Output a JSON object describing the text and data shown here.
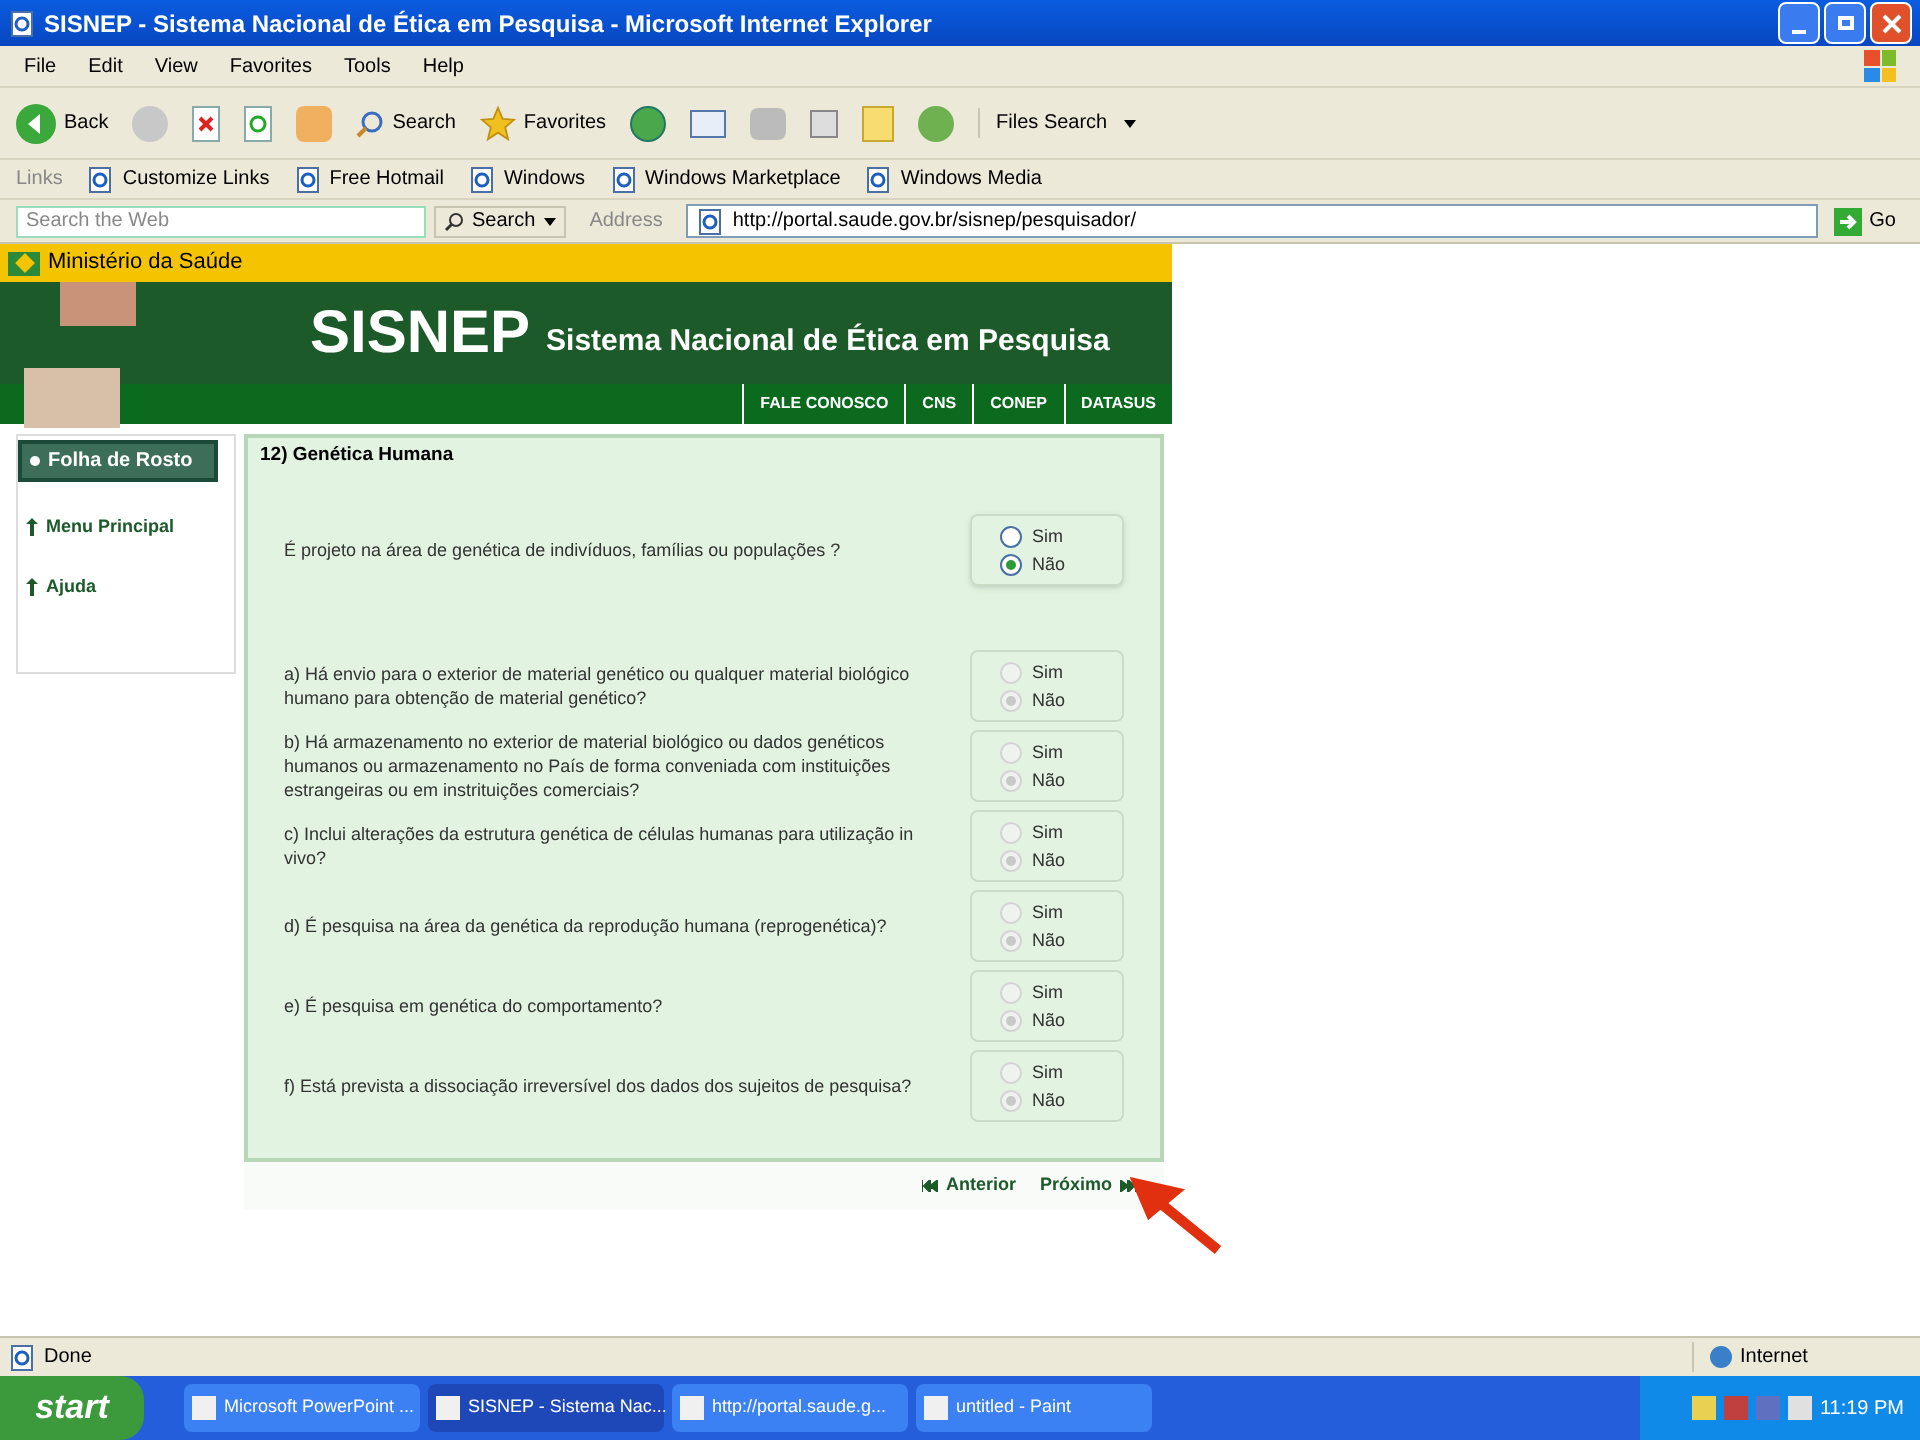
{
  "window": {
    "title": "SISNEP - Sistema Nacional de Ética em Pesquisa - Microsoft Internet Explorer"
  },
  "menu": [
    "File",
    "Edit",
    "View",
    "Favorites",
    "Tools",
    "Help"
  ],
  "toolbar": {
    "back": "Back",
    "search": "Search",
    "favorites": "Favorites",
    "files_search": "Files Search"
  },
  "links": {
    "label": "Links",
    "items": [
      "Customize Links",
      "Free Hotmail",
      "Windows",
      "Windows Marketplace",
      "Windows Media"
    ]
  },
  "search_bar": {
    "placeholder": "Search the Web",
    "button": "Search"
  },
  "address": {
    "label": "Address",
    "value": "http://portal.saude.gov.br/sisnep/pesquisador/",
    "go": "Go"
  },
  "page": {
    "ministry": "Ministério da Saúde",
    "logo": "SISNEP",
    "subtitle": "Sistema Nacional de Ética em Pesquisa",
    "nav": [
      "FALE CONOSCO",
      "CNS",
      "CONEP",
      "DATASUS"
    ],
    "sidebar": {
      "header": "Folha de Rosto",
      "items": [
        "Menu Principal",
        "Ajuda"
      ]
    },
    "section_title": "12) Genética Humana",
    "questions": [
      {
        "text": "É projeto na área de genética de indivíduos, famílias ou populações ?",
        "disabled": false,
        "options": [
          {
            "label": "Sim",
            "selected": false
          },
          {
            "label": "Não",
            "selected": true
          }
        ]
      },
      {
        "text": "a) Há envio para o exterior de material genético ou qualquer material biológico humano para obtenção de material genético?",
        "disabled": true,
        "options": [
          {
            "label": "Sim",
            "selected": false
          },
          {
            "label": "Não",
            "selected": true
          }
        ]
      },
      {
        "text": "b) Há armazenamento no exterior de material biológico ou dados genéticos humanos ou armazenamento no País de forma conveniada com instituições estrangeiras ou em instrituições comerciais?",
        "disabled": true,
        "options": [
          {
            "label": "Sim",
            "selected": false
          },
          {
            "label": "Não",
            "selected": true
          }
        ]
      },
      {
        "text": "c) Inclui alterações da estrutura genética de células humanas para utilização in vivo?",
        "disabled": true,
        "options": [
          {
            "label": "Sim",
            "selected": false
          },
          {
            "label": "Não",
            "selected": true
          }
        ]
      },
      {
        "text": "d) É pesquisa na área da genética da reprodução humana (reprogenética)?",
        "disabled": true,
        "options": [
          {
            "label": "Sim",
            "selected": false
          },
          {
            "label": "Não",
            "selected": true
          }
        ]
      },
      {
        "text": "e) É pesquisa em genética do comportamento?",
        "disabled": true,
        "options": [
          {
            "label": "Sim",
            "selected": false
          },
          {
            "label": "Não",
            "selected": true
          }
        ]
      },
      {
        "text": "f) Está prevista a dissociação irreversível dos dados dos sujeitos de pesquisa?",
        "disabled": true,
        "options": [
          {
            "label": "Sim",
            "selected": false
          },
          {
            "label": "Não",
            "selected": true
          }
        ]
      }
    ],
    "prev": "Anterior",
    "next": "Próximo"
  },
  "status_bar": {
    "status": "Done",
    "zone": "Internet"
  },
  "taskbar": {
    "start": "start",
    "tasks": [
      {
        "label": "Microsoft PowerPoint ...",
        "selected": false
      },
      {
        "label": "SISNEP - Sistema Nac...",
        "selected": true
      },
      {
        "label": "http://portal.saude.g...",
        "selected": false
      },
      {
        "label": "untitled - Paint",
        "selected": false
      }
    ],
    "clock": "11:19 PM"
  }
}
